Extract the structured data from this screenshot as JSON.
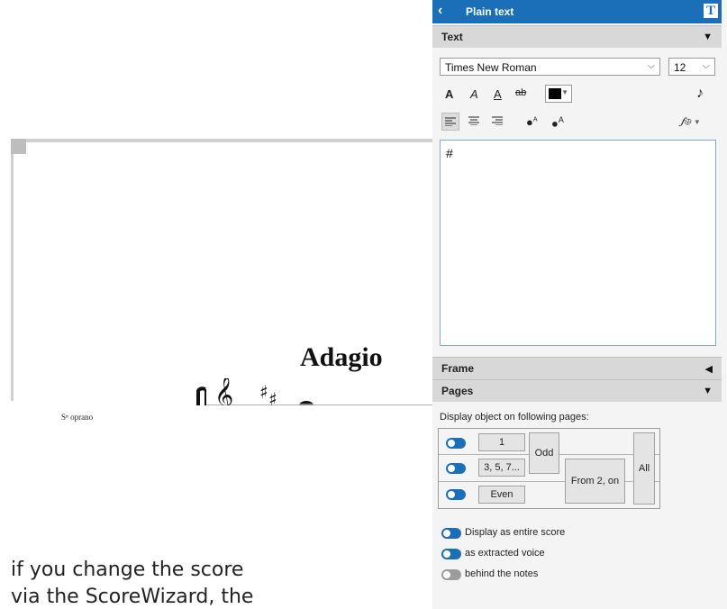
{
  "score": {
    "tempo": "Adagio",
    "voice_label": "Sⁿ oprano"
  },
  "body_text": {
    "line1": "if you change the score",
    "line2": "via the ScoreWizard, the"
  },
  "panel": {
    "title": "Plain text",
    "back_icon": "chevron-left",
    "title_icon_glyph": "T",
    "sections": {
      "text": "Text",
      "frame": "Frame",
      "pages": "Pages"
    },
    "font": {
      "family": "Times New Roman",
      "size": "12"
    },
    "format_buttons": {
      "bold": "A",
      "italic": "A",
      "underline": "A",
      "strike": "ab"
    },
    "color": "#000000",
    "accent": "#1a6fb8",
    "note_icon": "♪",
    "dyn_icon": "𝆑⊕",
    "text_content": "#",
    "pages": {
      "caption": "Display object on following pages:",
      "btn_first": "1",
      "btn_odd_pages": "3, 5, 7...",
      "btn_even": "Even",
      "btn_odd": "Odd",
      "btn_from2": "From 2, on",
      "btn_all": "All"
    },
    "options": [
      {
        "label": "Display as entire score",
        "on": true
      },
      {
        "label": "as extracted voice",
        "on": true
      },
      {
        "label": "behind the notes",
        "on": false
      }
    ]
  }
}
